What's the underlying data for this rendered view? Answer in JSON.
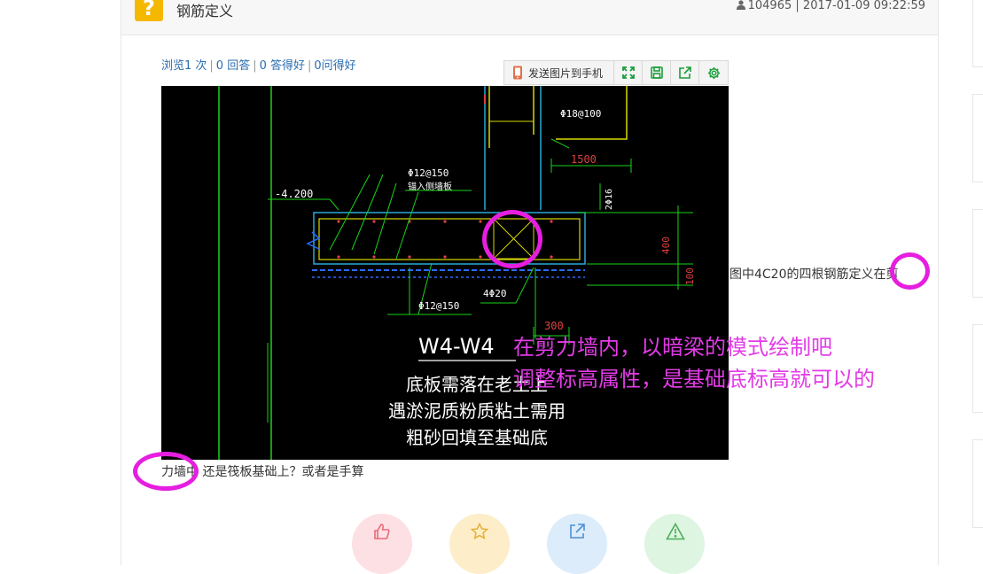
{
  "question": {
    "title": "钢筋定义",
    "user_id": "104965",
    "datetime": "2017-01-09 09:22:59"
  },
  "stats": {
    "views": "浏览1 次",
    "answers": "0 回答",
    "good_answers": "0 答得好",
    "good_questions": "0问得好"
  },
  "toolbar": {
    "send_label": "发送图片到手机"
  },
  "drawing": {
    "elev": "-4.200",
    "rebar_top": "Φ18@100",
    "dim_1500": "1500",
    "rebar_wall": "Φ12@150",
    "anchor_note": "锚入侧墙板",
    "rebar_side": "2Φ16",
    "rebar_bottom": "Φ12@150",
    "rebar_4": "4Φ20",
    "dim_300": "300",
    "dim_400": "400",
    "dim_100": "100",
    "section": "W4-W4",
    "note_1": "底板需落在老土上",
    "note_2": "遇淤泥质粉质粘土需用",
    "note_3": "粗砂回填至基础底"
  },
  "content": {
    "side_text": "图中4C20的四根钢筋定义在剪",
    "bottom_text": "力墙中 还是筏板基础上？或者是手算"
  },
  "annotation": {
    "line_1": "在剪力墙内，以暗梁的模式绘制吧",
    "line_2": "调整标高属性，是基础底标高就可以的"
  },
  "actions": [
    {
      "icon": "thumbs-up-icon",
      "color": "#fde0e3",
      "stroke": "#e96b7a"
    },
    {
      "icon": "star-icon",
      "color": "#fdeec9",
      "stroke": "#e8b23c"
    },
    {
      "icon": "share-icon",
      "color": "#dcecfb",
      "stroke": "#4d8fd6"
    },
    {
      "icon": "warning-icon",
      "color": "#def5e1",
      "stroke": "#4caf5a"
    }
  ]
}
